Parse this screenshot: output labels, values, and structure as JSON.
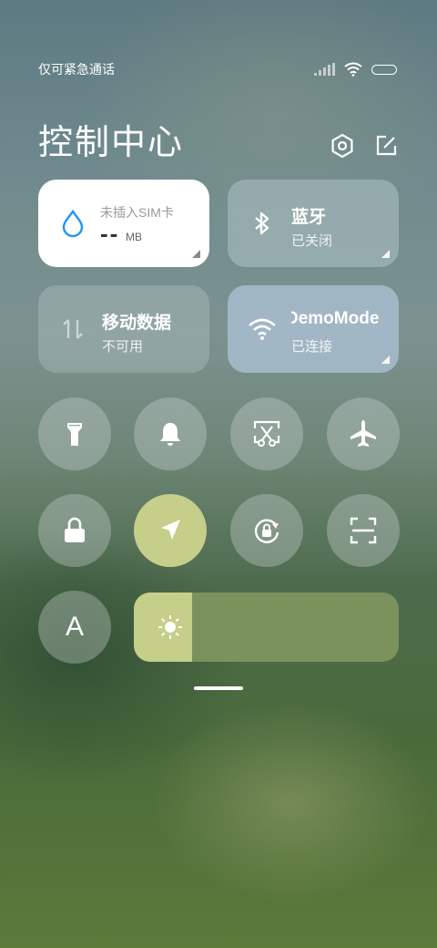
{
  "status_bar": {
    "carrier_text": "仅可紧急通话"
  },
  "header": {
    "title": "控制中心"
  },
  "cards": {
    "data_usage": {
      "label": "未插入SIM卡",
      "value": "--",
      "unit": "MB"
    },
    "bluetooth": {
      "title": "蓝牙",
      "status": "已关闭"
    },
    "mobile_data": {
      "title": "移动数据",
      "status": "不可用"
    },
    "wifi": {
      "title": "DemoMode",
      "status": "已连接"
    }
  },
  "toggles": {
    "flashlight": "flashlight-icon",
    "mute": "bell-icon",
    "screenshot": "scissors-icon",
    "airplane": "airplane-icon",
    "lock": "lock-icon",
    "location": {
      "icon": "location-arrow-icon",
      "state": "on"
    },
    "rotation_lock": "rotation-lock-icon",
    "scanner": "scan-icon",
    "reading_mode": "A"
  },
  "brightness": {
    "level_fraction": 0.22
  },
  "colors": {
    "accent": "#c5cf8a",
    "data_icon": "#2196f3"
  }
}
